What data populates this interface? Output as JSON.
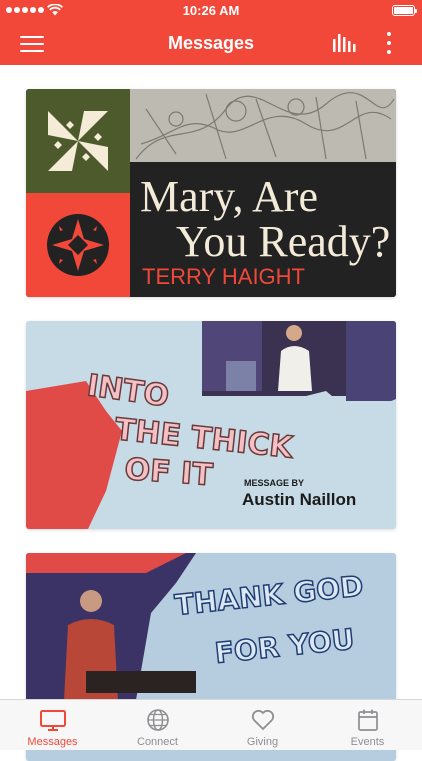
{
  "status_bar": {
    "time": "10:26 AM"
  },
  "nav": {
    "title": "Messages"
  },
  "messages": [
    {
      "title_line1": "Mary, Are",
      "title_line2": "You Ready?",
      "speaker": "TERRY HAIGHT"
    },
    {
      "title_lines": [
        "INTO",
        "THE THICK",
        "OF IT"
      ],
      "byline": "MESSAGE BY",
      "speaker": "Austin Naillon"
    },
    {
      "title_lines": [
        "THANK GOD",
        "FOR YOU"
      ]
    }
  ],
  "tabs": [
    {
      "label": "Messages",
      "icon": "tv-icon"
    },
    {
      "label": "Connect",
      "icon": "globe-icon"
    },
    {
      "label": "Giving",
      "icon": "heart-icon"
    },
    {
      "label": "Events",
      "icon": "calendar-icon"
    }
  ],
  "colors": {
    "brand_red": "#f1483a",
    "olive": "#4d5a2b",
    "tab_inactive": "#8e8e93"
  }
}
